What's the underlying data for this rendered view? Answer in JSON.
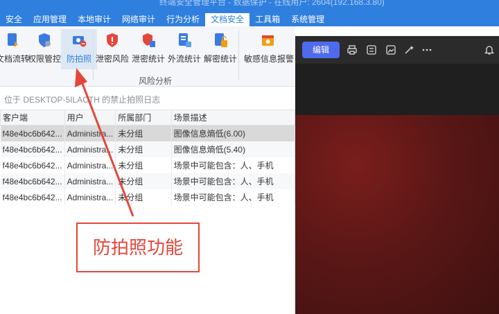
{
  "window": {
    "title": "终端安全管理平台 - 数据保护 - 在线用户: 2604(192.168.3.80)"
  },
  "menu": {
    "tabs": [
      {
        "label": "安全",
        "active": false
      },
      {
        "label": "应用管理",
        "active": false
      },
      {
        "label": "本地审计",
        "active": false
      },
      {
        "label": "网络审计",
        "active": false
      },
      {
        "label": "行为分析",
        "active": false
      },
      {
        "label": "文档安全",
        "active": true
      },
      {
        "label": "工具箱",
        "active": false
      },
      {
        "label": "系统管理",
        "active": false
      }
    ]
  },
  "ribbon": {
    "buttons": [
      {
        "label": "文档流转",
        "icon": "document-flow-icon"
      },
      {
        "label": "权限管控",
        "icon": "permission-shield-icon"
      },
      {
        "label": "防拍照",
        "icon": "anti-photo-camera-icon",
        "active": true
      },
      {
        "label": "泄密风险",
        "icon": "leak-risk-shield-icon"
      },
      {
        "label": "泄密统计",
        "icon": "leak-stats-icon"
      },
      {
        "label": "外流统计",
        "icon": "outflow-stats-icon"
      },
      {
        "label": "解密统计",
        "icon": "decrypt-stats-icon"
      },
      {
        "label": "敏感信息报警",
        "icon": "sensitive-alert-icon"
      }
    ],
    "group_label": "风险分析"
  },
  "breadcrumb": "位于 DESKTOP-5ILACTH 的禁止拍照日志",
  "table": {
    "columns": [
      "客户端",
      "用户",
      "所属部门",
      "场景描述"
    ],
    "rows": [
      {
        "client": "f48e4bc6b642...",
        "user": "Administra...",
        "dept": "未分组",
        "desc": "图像信息熵低(6.00)",
        "selected": true
      },
      {
        "client": "f48e4bc6b642...",
        "user": "Administra...",
        "dept": "未分组",
        "desc": "图像信息熵低(5.40)"
      },
      {
        "client": "f48e4bc6b642...",
        "user": "Administra...",
        "dept": "未分组",
        "desc": "场景中可能包含：人、手机"
      },
      {
        "client": "f48e4bc6b642...",
        "user": "Administra...",
        "dept": "未分组",
        "desc": "场景中可能包含：人、手机"
      },
      {
        "client": "f48e4bc6b642...",
        "user": "Administra...",
        "dept": "未分组",
        "desc": "场景中可能包含：人、手机"
      }
    ]
  },
  "viewer": {
    "edit_label": "编辑",
    "toolbar_icons": [
      "print-icon",
      "adjust-icon",
      "image-edit-icon",
      "ai-sparkle-icon",
      "more-icon",
      "bell-icon"
    ]
  },
  "callout": {
    "text": "防拍照功能"
  },
  "colors": {
    "accent": "#2f7fde",
    "annotation": "#e5463a",
    "edit_button": "#4f6bed"
  }
}
